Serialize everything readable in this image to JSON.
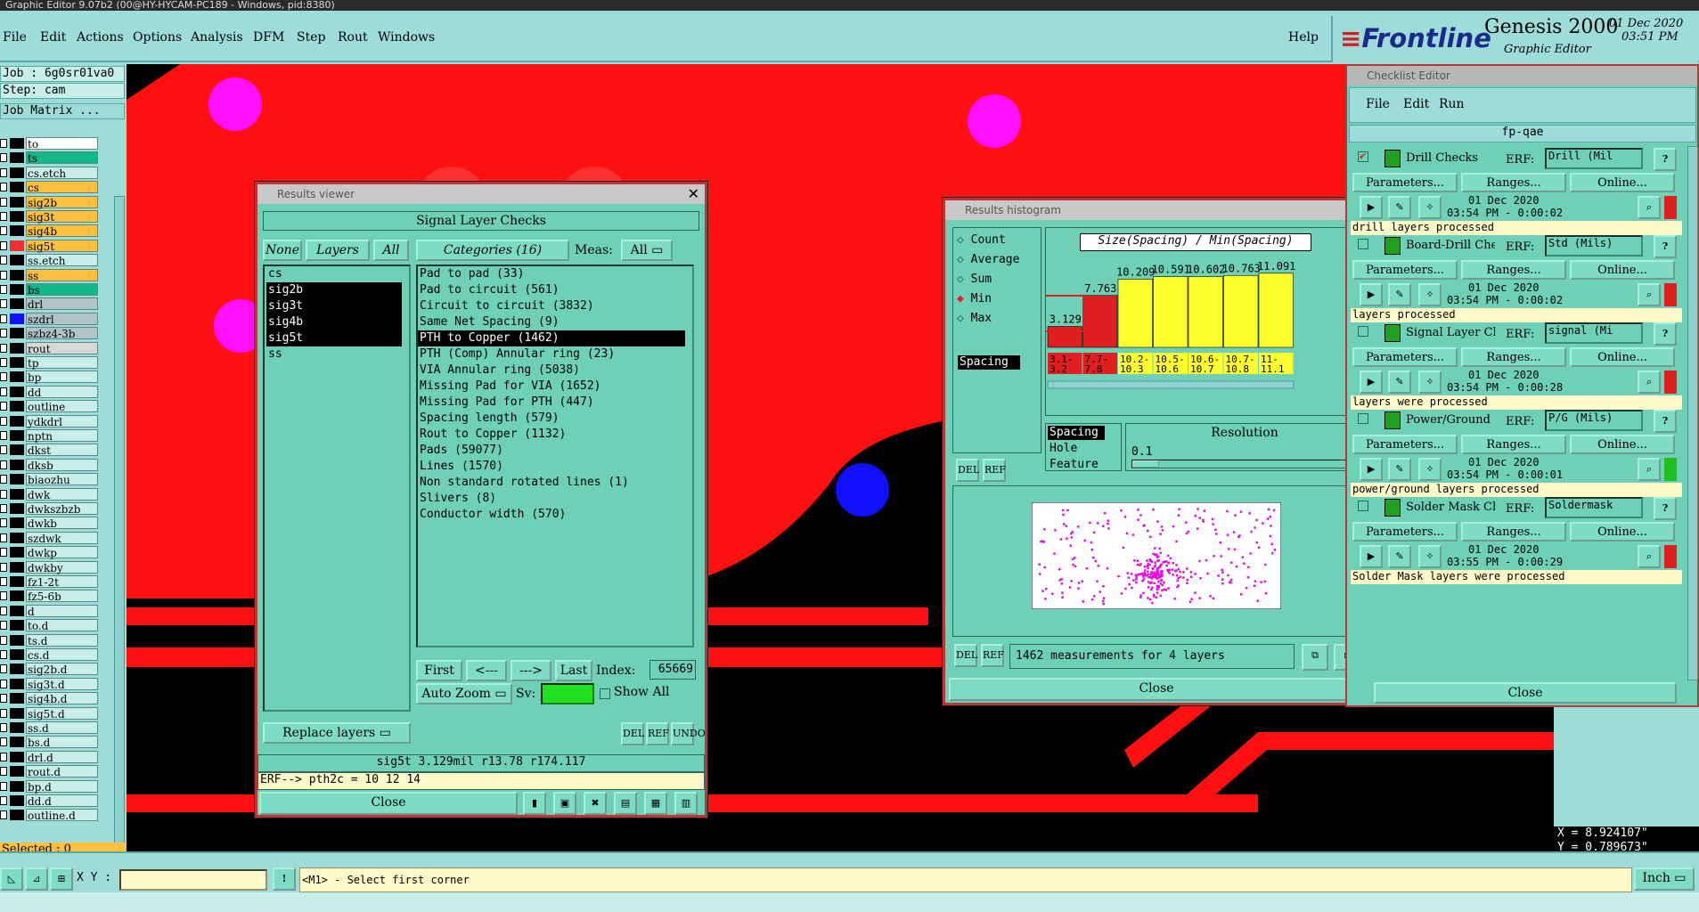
{
  "window_title": "Graphic Editor 9.07b2 (00@HY-HYCAM-PC189 - Windows, pid:8380)",
  "menu": [
    "File",
    "Edit",
    "Actions",
    "Options",
    "Analysis",
    "DFM",
    "Step",
    "Rout",
    "Windows"
  ],
  "help_label": "Help",
  "brand": {
    "logo": "Frontline",
    "product": "Genesis 2000",
    "subtitle": "Graphic Editor",
    "date": "01 Dec 2020",
    "time": "03:51 PM"
  },
  "left_panel": {
    "job": "Job : 6g0sr01va0",
    "step": "Step: cam",
    "job_matrix": "Job Matrix ...",
    "layers": [
      {
        "name": "to",
        "color": "#ffffff"
      },
      {
        "name": "ts",
        "color": "#12b88a"
      },
      {
        "name": "cs.etch",
        "color": "#c8eeea"
      },
      {
        "name": "cs",
        "color": "#ffc040"
      },
      {
        "name": "sig2b",
        "color": "#ffc040"
      },
      {
        "name": "sig3t",
        "color": "#ffc040"
      },
      {
        "name": "sig4b",
        "color": "#ffc040"
      },
      {
        "name": "sig5t",
        "color": "#ffc040"
      },
      {
        "name": "ss.etch",
        "color": "#c8eeea"
      },
      {
        "name": "ss",
        "color": "#ffc040"
      },
      {
        "name": "bs",
        "color": "#12b88a"
      },
      {
        "name": "drl",
        "color": "#b0c4c8"
      },
      {
        "name": "szdrl",
        "color": "#b0c4c8"
      },
      {
        "name": "szbz4-3b",
        "color": "#b0c4c8"
      },
      {
        "name": "rout",
        "color": "#d8d8d8"
      },
      {
        "name": "tp",
        "color": "#c8eeea"
      },
      {
        "name": "bp",
        "color": "#c8eeea"
      },
      {
        "name": "dd",
        "color": "#c8eeea"
      },
      {
        "name": "outline",
        "color": "#c8eeea"
      },
      {
        "name": "ydkdrl",
        "color": "#c8eeea"
      },
      {
        "name": "nptn",
        "color": "#c8eeea"
      },
      {
        "name": "dkst",
        "color": "#c8eeea"
      },
      {
        "name": "dksb",
        "color": "#c8eeea"
      },
      {
        "name": "biaozhu",
        "color": "#c8eeea"
      },
      {
        "name": "dwk",
        "color": "#c8eeea"
      },
      {
        "name": "dwkszbzb",
        "color": "#c8eeea"
      },
      {
        "name": "dwkb",
        "color": "#c8eeea"
      },
      {
        "name": "szdwk",
        "color": "#c8eeea"
      },
      {
        "name": "dwkp",
        "color": "#c8eeea"
      },
      {
        "name": "dwkby",
        "color": "#c8eeea"
      },
      {
        "name": "fz1-2t",
        "color": "#c8eeea"
      },
      {
        "name": "fz5-6b",
        "color": "#c8eeea"
      },
      {
        "name": "d",
        "color": "#c8eeea"
      },
      {
        "name": "to.d",
        "color": "#c8eeea"
      },
      {
        "name": "ts.d",
        "color": "#c8eeea"
      },
      {
        "name": "cs.d",
        "color": "#c8eeea"
      },
      {
        "name": "sig2b.d",
        "color": "#c8eeea"
      },
      {
        "name": "sig3t.d",
        "color": "#c8eeea"
      },
      {
        "name": "sig4b.d",
        "color": "#c8eeea"
      },
      {
        "name": "sig5t.d",
        "color": "#c8eeea"
      },
      {
        "name": "ss.d",
        "color": "#c8eeea"
      },
      {
        "name": "bs.d",
        "color": "#c8eeea"
      },
      {
        "name": "drl.d",
        "color": "#c8eeea"
      },
      {
        "name": "rout.d",
        "color": "#c8eeea"
      },
      {
        "name": "bp.d",
        "color": "#c8eeea"
      },
      {
        "name": "dd.d",
        "color": "#c8eeea"
      },
      {
        "name": "outline.d",
        "color": "#c8eeea"
      }
    ],
    "selected": "Selected : 0"
  },
  "results_viewer": {
    "title": "Results viewer",
    "header": "Signal Layer Checks",
    "none_label": "None",
    "layers_label": "Layers",
    "all_label": "All",
    "categories_label": "Categories (16)",
    "meas_label": "Meas:",
    "meas_value": "All",
    "layer_list": [
      "cs",
      "sig2b",
      "sig3t",
      "sig4b",
      "sig5t",
      "ss"
    ],
    "categories": [
      "Pad to pad (33)",
      "Pad to circuit (561)",
      "Circuit to circuit (3832)",
      "Same Net Spacing (9)",
      "PTH to Copper (1462)",
      "PTH (Comp) Annular ring (23)",
      "VIA Annular ring (5038)",
      "Missing Pad for VIA (1652)",
      "Missing Pad for PTH (447)",
      "Spacing length (579)",
      "Rout to Copper (1132)",
      "Pads (59077)",
      "Lines (1570)",
      "Non standard rotated lines (1)",
      "Slivers (8)",
      "Conductor width (570)"
    ],
    "nav": {
      "first": "First",
      "prev": "<---",
      "next": "--->",
      "last": "Last",
      "index_label": "Index:",
      "index_value": "65669"
    },
    "auto_zoom": "Auto Zoom",
    "sv_label": "Sv:",
    "show_all": "Show All",
    "replace_layers": "Replace layers",
    "del": "DEL",
    "ref": "REF",
    "undo": "UNDO",
    "info": "sig5t 3.129mil  r13.78  r174.117",
    "erf": "ERF--> pth2c = 10 12 14",
    "close": "Close"
  },
  "histogram": {
    "title": "Results histogram",
    "options": [
      "Count",
      "Average",
      "Sum",
      "Min",
      "Max"
    ],
    "selected_option": "Min",
    "spacing_tag": "Spacing",
    "chart_title": "Size(Spacing) / Min(Spacing)",
    "del": "DEL",
    "ref": "REF",
    "types": [
      "Spacing",
      "Hole",
      "Feature"
    ],
    "resolution_label": "Resolution",
    "resolution_value": "0.1",
    "measure_text": "1462 measurements for 4 layers",
    "close": "Close"
  },
  "chart_data": {
    "type": "bar",
    "title": "Size(Spacing) / Min(Spacing)",
    "bar_labels": [
      "3.129",
      "7.763",
      "10.209",
      "10.591",
      "10.602",
      "10.763",
      "11.091"
    ],
    "categories": [
      "3.1-3.2",
      "7.7-7.8",
      "10.2-10.3",
      "10.5-10.6",
      "10.6-10.7",
      "10.7-10.8",
      "11-11.1"
    ],
    "values": [
      3.129,
      7.763,
      10.209,
      10.591,
      10.602,
      10.763,
      11.091
    ],
    "colors": [
      "#e02020",
      "#e02020",
      "#ffff30",
      "#ffff30",
      "#ffff30",
      "#ffff30",
      "#ffff30"
    ],
    "ylim": [
      0,
      12
    ]
  },
  "checklist": {
    "title": "Checklist Editor",
    "menu": [
      "File",
      "Edit",
      "Run"
    ],
    "name": "fp-qae",
    "erf_label": "ERF:",
    "parameters": "Parameters...",
    "ranges": "Ranges...",
    "online": "Online...",
    "close": "Close",
    "items": [
      {
        "name": "Drill Checks",
        "erf": "Drill (Mil",
        "date": "01 Dec 2020",
        "time": "03:54 PM - 0:00:02",
        "status": "drill layers processed",
        "checked": true
      },
      {
        "name": "Board-Drill Che",
        "erf": "Std (Mils)",
        "date": "01 Dec 2020",
        "time": "03:54 PM - 0:00:02",
        "status": "layers processed",
        "checked": false
      },
      {
        "name": "Signal Layer Ch",
        "erf": "signal (Mi",
        "date": "01 Dec 2020",
        "time": "03:54 PM - 0:00:28",
        "status": "layers were processed",
        "checked": false
      },
      {
        "name": "Power/Ground C",
        "erf": "P/G (Mils)",
        "date": "01 Dec 2020",
        "time": "03:54 PM - 0:00:01",
        "status": "power/ground layers processed",
        "checked": false
      },
      {
        "name": "Solder Mask Ch",
        "erf": "Soldermask",
        "date": "01 Dec 2020",
        "time": "03:55 PM - 0:00:29",
        "status": "Solder Mask layers were processed",
        "checked": false
      }
    ]
  },
  "status": {
    "xy_label": "X Y :",
    "xy_value": "",
    "prompt": "<M1> - Select first corner",
    "x_readout": "X = 8.924107\"",
    "y_readout": "Y = 0.789673\"",
    "units": "Inch"
  }
}
